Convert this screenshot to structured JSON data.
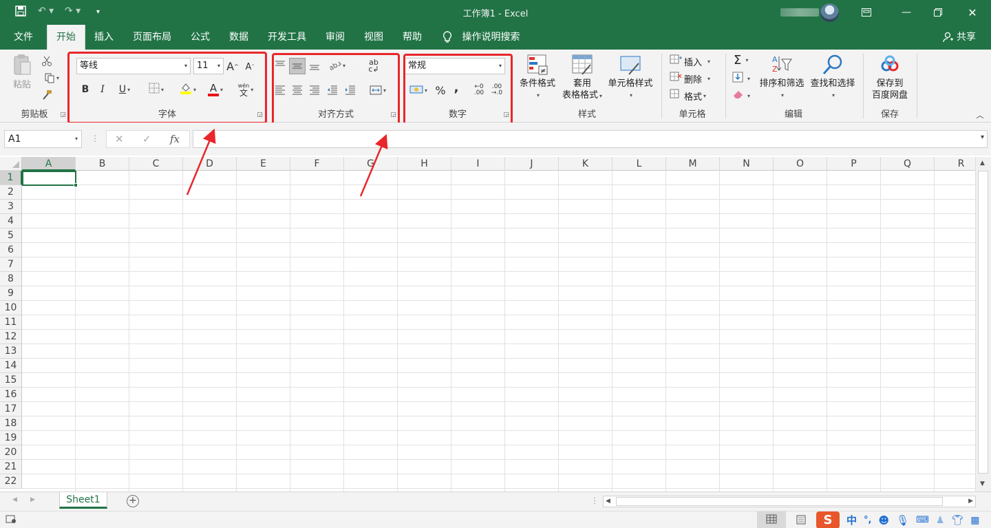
{
  "titlebar": {
    "title": "工作簿1  -  Excel",
    "save_icon": "save-icon",
    "undo_icon": "undo-icon",
    "redo_icon": "redo-icon",
    "customize_icon": "customize-qat-icon"
  },
  "tabs": [
    "文件",
    "开始",
    "插入",
    "页面布局",
    "公式",
    "数据",
    "开发工具",
    "审阅",
    "视图",
    "帮助"
  ],
  "tell_me": "操作说明搜索",
  "share": "共享",
  "ribbon": {
    "clipboard": {
      "paste": "粘贴",
      "label": "剪贴板"
    },
    "font": {
      "name": "等线",
      "size": "11",
      "bold": "B",
      "italic": "I",
      "underline": "U",
      "grow": "A",
      "shrink": "A",
      "phonetic": "文",
      "phonetic_top": "wén",
      "label": "字体"
    },
    "alignment": {
      "wrap": "ab",
      "label": "对齐方式"
    },
    "number": {
      "format": "常规",
      "percent": "%",
      "comma": ",",
      "inc_dec": ".00",
      "label": "数字"
    },
    "styles": {
      "conditional": "条件格式",
      "table_l1": "套用",
      "table_l2": "表格格式",
      "cell_styles": "单元格样式",
      "label": "样式"
    },
    "cells": {
      "insert": "插入",
      "delete": "删除",
      "format": "格式",
      "label": "单元格"
    },
    "editing": {
      "sigma": "Σ",
      "sort_filter": "排序和筛选",
      "find_select": "查找和选择",
      "label": "编辑"
    },
    "save": {
      "l1": "保存到",
      "l2": "百度网盘",
      "label": "保存"
    }
  },
  "formula_bar": {
    "name_box": "A1",
    "cancel": "✕",
    "enter": "✓",
    "fx": "fx",
    "value": ""
  },
  "columns": [
    "A",
    "B",
    "C",
    "D",
    "E",
    "F",
    "G",
    "H",
    "I",
    "J",
    "K",
    "L",
    "M",
    "N",
    "O",
    "P",
    "Q",
    "R"
  ],
  "rows": [
    "1",
    "2",
    "3",
    "4",
    "5",
    "6",
    "7",
    "8",
    "9",
    "10",
    "11",
    "12",
    "13",
    "14",
    "15",
    "16",
    "17",
    "18",
    "19",
    "20",
    "21",
    "22"
  ],
  "sheets": {
    "active": "Sheet1",
    "add": "+"
  },
  "ime": {
    "logo": "S",
    "mode": "中",
    "punct": "°,"
  },
  "colors": {
    "brand": "#217346",
    "highlight": "#e8262b"
  }
}
